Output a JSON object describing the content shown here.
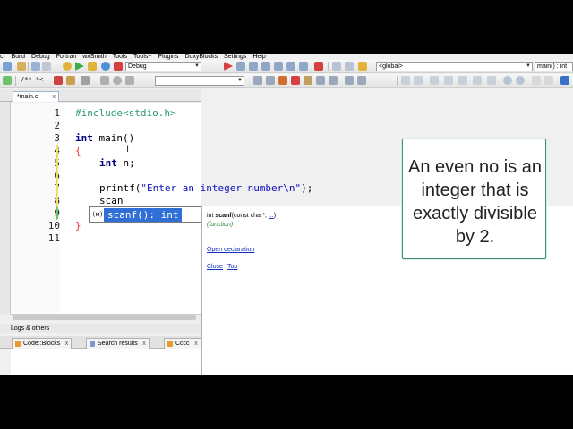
{
  "menubar": {
    "items": [
      "ct",
      "Build",
      "Debug",
      "Fortran",
      "wxSmith",
      "Tools",
      "Tools+",
      "Plugins",
      "DoxyBlocks",
      "Settings",
      "Help"
    ]
  },
  "toolbar": {
    "build_target": "Debug",
    "scope": "<global>",
    "symbol": "main() : int",
    "comment_btn": "/** *<",
    "search_combo": ""
  },
  "editor": {
    "tab_label": "*main.c",
    "tab_close": "x",
    "line_numbers": [
      "1",
      "2",
      "3",
      "4",
      "5",
      "6",
      "7",
      "8",
      "9",
      "10",
      "11"
    ],
    "lines": {
      "l1": "#include<stdio.h>",
      "l3a": "int",
      "l3b": " main()",
      "l4": "{",
      "l5a": "int",
      "l5b": " n;",
      "l7a": "printf(",
      "l7b": "\"Enter an integer number\\n\"",
      "l7c": ");",
      "l8": "scan",
      "l10": "}"
    }
  },
  "autocomplete": {
    "badge": "(м)",
    "item": "scanf(): int"
  },
  "doc_panel": {
    "sig_prefix": "int ",
    "sig_name": "scanf",
    "sig_params": "(const char*, ",
    "sig_ellipsis": "...",
    "sig_close": ")",
    "kind": "(function)",
    "open_decl": "Open declaration",
    "close": "Close",
    "top": "Top"
  },
  "logs": {
    "header": "Logs & others",
    "tabs": [
      "Code::Blocks",
      "Search results",
      "Cccc"
    ],
    "tab_close": "x"
  },
  "callout": {
    "text": "An even no is an integer that is exactly divisible by 2."
  }
}
